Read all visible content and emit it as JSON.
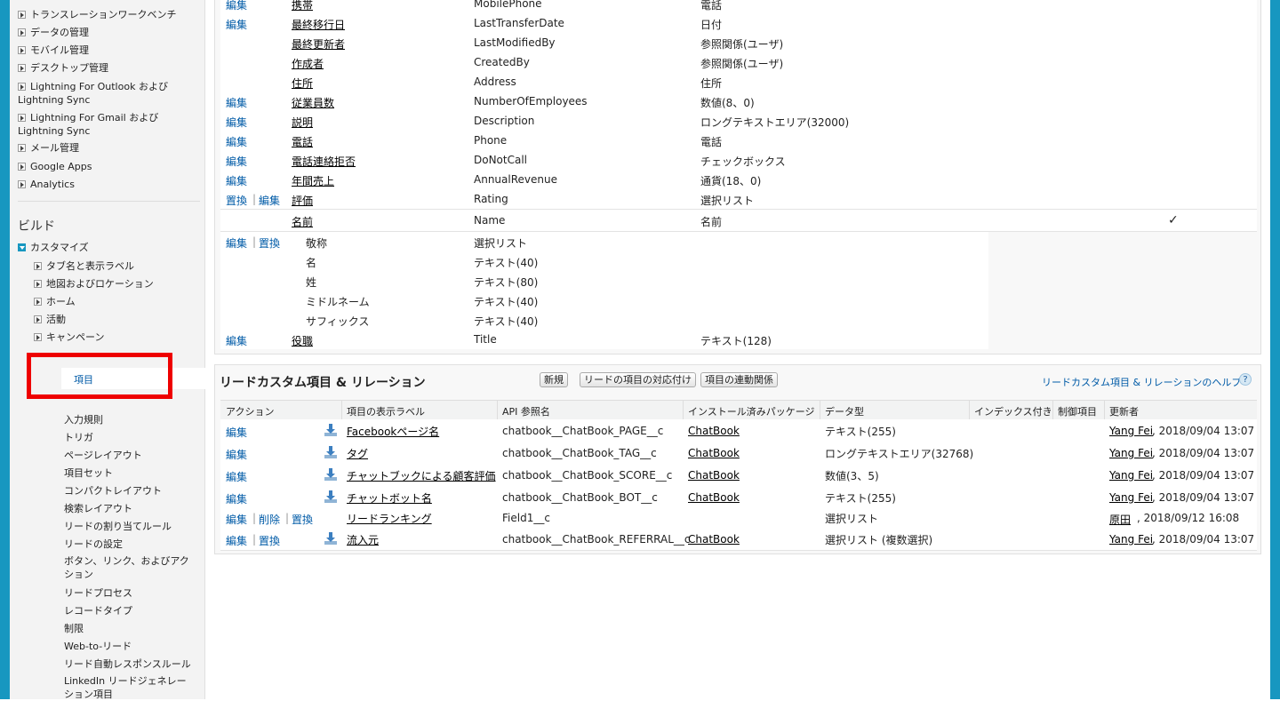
{
  "sidebar": {
    "top_items": [
      "トランスレーションワークベンチ",
      "データの管理",
      "モバイル管理",
      "デスクトップ管理",
      "Lightning For Outlook および Lightning Sync",
      "Lightning For Gmail および Lightning Sync",
      "メール管理",
      "Google Apps",
      "Analytics"
    ],
    "build_heading": "ビルド",
    "customize": "カスタマイズ",
    "customize_children": [
      "タブ名と表示ラベル",
      "地図およびロケーション",
      "ホーム",
      "活動",
      "キャンペーン"
    ],
    "selected": "項目",
    "lead_children": [
      "入力規則",
      "トリガ",
      "ページレイアウト",
      "項目セット",
      "コンパクトレイアウト",
      "検索レイアウト",
      "リードの割り当てルール",
      "リードの設定",
      "ボタン、リンク、およびアクション",
      "リードプロセス",
      "レコードタイプ",
      "制限",
      "Web-to-リード",
      "リード自動レスポンスルール",
      "LinkedIn リードジェネレーション項目"
    ]
  },
  "standard_fields": {
    "rows": [
      {
        "action": "編集",
        "label": "携帯",
        "api": "MobilePhone",
        "type": "電話"
      },
      {
        "action": "編集",
        "label": "最終移行日",
        "api": "LastTransferDate",
        "type": "日付"
      },
      {
        "action": "",
        "label": "最終更新者",
        "api": "LastModifiedBy",
        "type": "参照関係(ユーザ)"
      },
      {
        "action": "",
        "label": "作成者",
        "api": "CreatedBy",
        "type": "参照関係(ユーザ)"
      },
      {
        "action": "",
        "label": "住所",
        "api": "Address",
        "type": "住所"
      },
      {
        "action": "編集",
        "label": "従業員数",
        "api": "NumberOfEmployees",
        "type": "数値(8、0)"
      },
      {
        "action": "編集",
        "label": "説明",
        "api": "Description",
        "type": "ロングテキストエリア(32000)"
      },
      {
        "action": "編集",
        "label": "電話",
        "api": "Phone",
        "type": "電話"
      },
      {
        "action": "編集",
        "label": "電話連絡拒否",
        "api": "DoNotCall",
        "type": "チェックボックス"
      },
      {
        "action": "編集",
        "label": "年間売上",
        "api": "AnnualRevenue",
        "type": "通貨(18、0)"
      },
      {
        "action": "置換",
        "action2": "編集",
        "label": "評価",
        "api": "Rating",
        "type": "選択リスト"
      },
      {
        "action": "",
        "label": "名前",
        "api": "Name",
        "type": "名前",
        "check": "✓"
      }
    ],
    "name_subrows": [
      {
        "action": "編集",
        "action2": "置換",
        "label": "敬称",
        "type": "選択リスト"
      },
      {
        "label": "名",
        "type": "テキスト(40)"
      },
      {
        "label": "姓",
        "type": "テキスト(80)"
      },
      {
        "label": "ミドルネーム",
        "type": "テキスト(40)"
      },
      {
        "label": "サフィックス",
        "type": "テキスト(40)"
      }
    ],
    "last_row": {
      "action": "編集",
      "label": "役職",
      "api": "Title",
      "type": "テキスト(128)"
    }
  },
  "custom_section": {
    "title": "リードカスタム項目 & リレーション",
    "buttons": [
      "新規",
      "リードの項目の対応付け",
      "項目の連動関係"
    ],
    "help_link": "リードカスタム項目 & リレーションのヘルプ",
    "help_icon": "?",
    "columns": [
      "アクション",
      "項目の表示ラベル",
      "API 参照名",
      "インストール済みパッケージ",
      "データ型",
      "インデックス付き",
      "制御項目",
      "更新者"
    ],
    "rows": [
      {
        "actions": [
          "編集"
        ],
        "download": true,
        "label": "Facebookページ名",
        "api": "chatbook__ChatBook_PAGE__c",
        "package": "ChatBook",
        "type": "テキスト(255)",
        "user": "Yang Fei",
        "date": ", 2018/09/04 13:07"
      },
      {
        "actions": [
          "編集"
        ],
        "download": true,
        "label": "タグ",
        "api": "chatbook__ChatBook_TAG__c",
        "package": "ChatBook",
        "type": "ロングテキストエリア(32768)",
        "user": "Yang Fei",
        "date": ", 2018/09/04 13:07"
      },
      {
        "actions": [
          "編集"
        ],
        "download": true,
        "label": "チャットブックによる顧客評価",
        "api": "chatbook__ChatBook_SCORE__c",
        "package": "ChatBook",
        "type": "数値(3、5)",
        "user": "Yang Fei",
        "date": ", 2018/09/04 13:07"
      },
      {
        "actions": [
          "編集"
        ],
        "download": true,
        "label": "チャットボット名",
        "api": "chatbook__ChatBook_BOT__c",
        "package": "ChatBook",
        "type": "テキスト(255)",
        "user": "Yang Fei",
        "date": ", 2018/09/04 13:07"
      },
      {
        "actions": [
          "編集",
          "削除",
          "置換"
        ],
        "download": false,
        "label": "リードランキング",
        "api": "Field1__c",
        "package": "",
        "type": "選択リスト",
        "user": "原田",
        "date": ", 2018/09/12 16:08"
      },
      {
        "actions": [
          "編集",
          "置換"
        ],
        "download": true,
        "label": "流入元",
        "api": "chatbook__ChatBook_REFERRAL__c",
        "package": "ChatBook",
        "type": "選択リスト (複数選択)",
        "user": "Yang Fei",
        "date": ", 2018/09/04 13:07"
      }
    ]
  },
  "colors": {
    "accent": "#1797c0",
    "link": "#015ba7",
    "highlight": "#ee0000"
  }
}
